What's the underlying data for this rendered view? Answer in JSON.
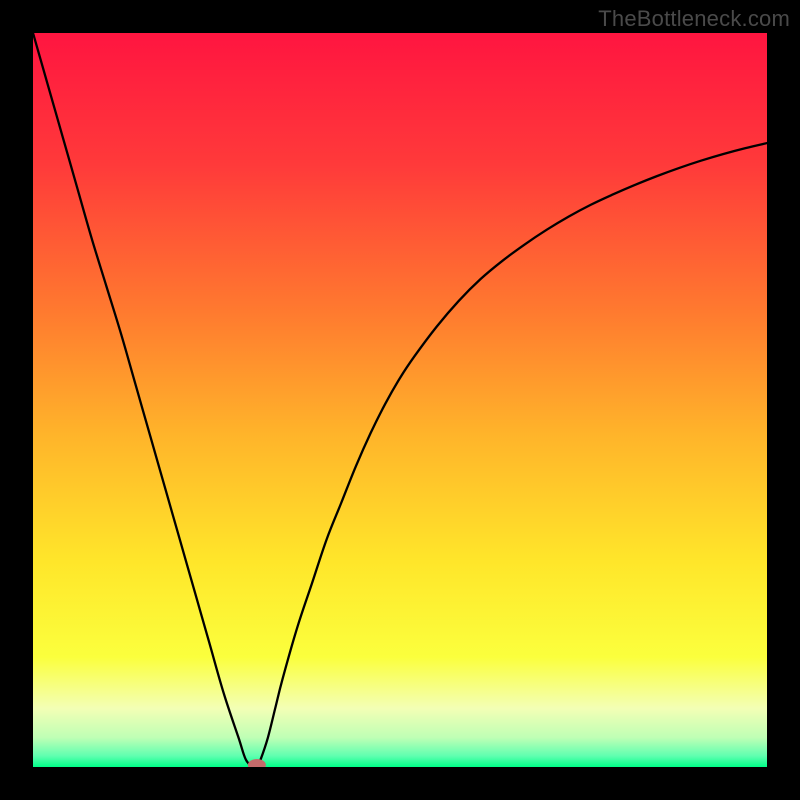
{
  "watermark": "TheBottleneck.com",
  "chart_data": {
    "type": "line",
    "title": "",
    "xlabel": "",
    "ylabel": "",
    "xlim": [
      0,
      100
    ],
    "ylim": [
      0,
      100
    ],
    "x": [
      0,
      2,
      4,
      6,
      8,
      10,
      12,
      14,
      16,
      18,
      20,
      22,
      24,
      26,
      28,
      29,
      30,
      30.5,
      31,
      32,
      33,
      34,
      36,
      38,
      40,
      42,
      44,
      46,
      48,
      50,
      52,
      55,
      58,
      61,
      64,
      67,
      70,
      73,
      76,
      79,
      82,
      85,
      88,
      91,
      94,
      97,
      100
    ],
    "values": [
      100,
      93,
      86,
      79,
      72,
      65.5,
      59,
      52,
      45,
      38,
      31,
      24,
      17,
      10,
      4,
      1,
      0,
      0,
      1,
      4,
      8,
      12,
      19,
      25,
      31,
      36,
      41,
      45.5,
      49.5,
      53,
      56,
      60,
      63.5,
      66.5,
      69,
      71.2,
      73.2,
      75,
      76.6,
      78,
      79.3,
      80.5,
      81.6,
      82.6,
      83.5,
      84.3,
      85
    ],
    "curve_min_x": 30.5,
    "marker": {
      "x": 30.5,
      "y": 0,
      "color": "#c46b6b"
    },
    "background": {
      "type": "vertical_gradient",
      "stops": [
        {
          "pos": 0.0,
          "color": "#ff1540"
        },
        {
          "pos": 0.18,
          "color": "#ff3a3a"
        },
        {
          "pos": 0.38,
          "color": "#ff7a2f"
        },
        {
          "pos": 0.55,
          "color": "#ffb52a"
        },
        {
          "pos": 0.72,
          "color": "#ffe62a"
        },
        {
          "pos": 0.85,
          "color": "#fbff3d"
        },
        {
          "pos": 0.92,
          "color": "#f3ffb5"
        },
        {
          "pos": 0.96,
          "color": "#bfffb5"
        },
        {
          "pos": 0.985,
          "color": "#5fffb0"
        },
        {
          "pos": 1.0,
          "color": "#00ff88"
        }
      ]
    }
  }
}
